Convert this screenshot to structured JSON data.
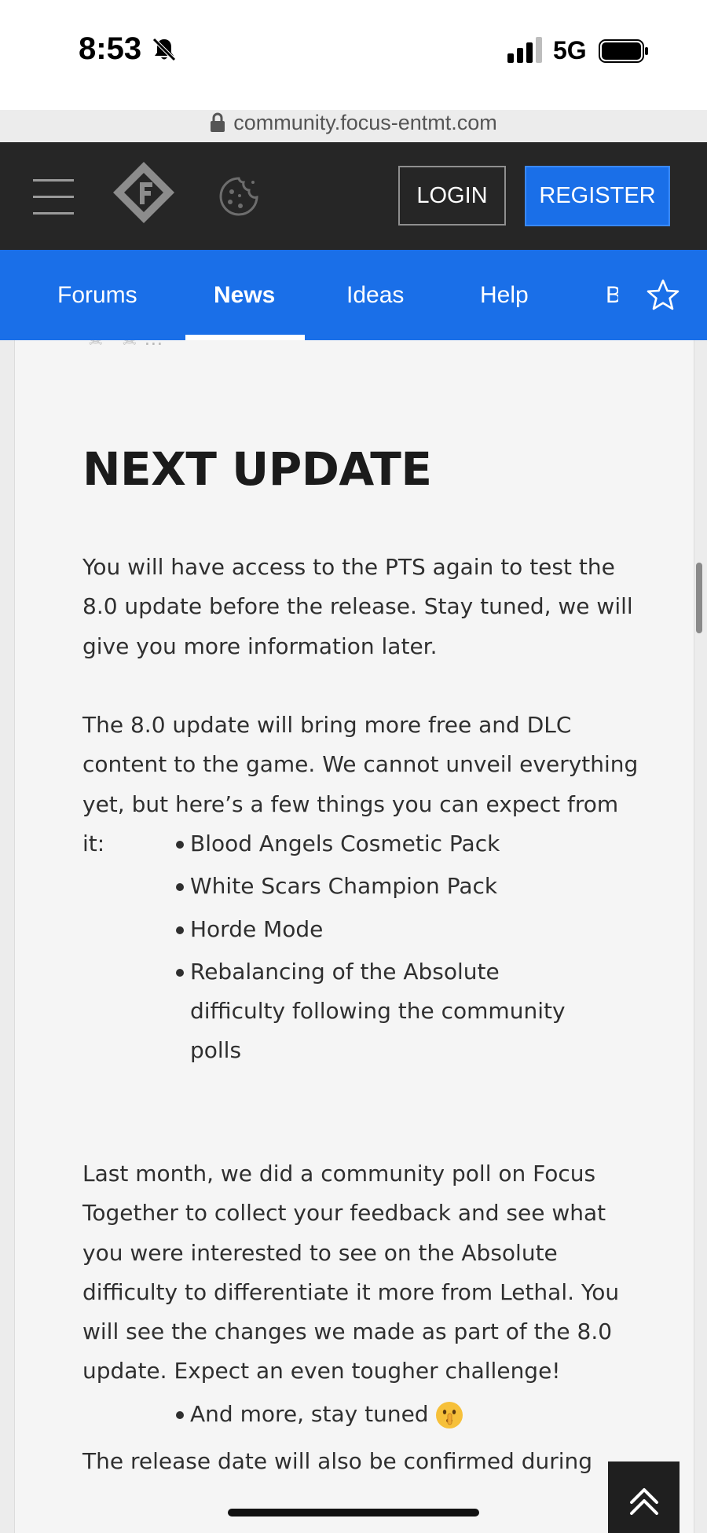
{
  "status": {
    "time": "8:53",
    "network": "5G"
  },
  "browser": {
    "url": "community.focus-entmt.com"
  },
  "header": {
    "login_label": "LOGIN",
    "register_label": "REGISTER"
  },
  "subnav": {
    "tabs": [
      "Forums",
      "News",
      "Ideas",
      "Help",
      "B"
    ],
    "active": "News"
  },
  "article": {
    "top_fragment": "…",
    "heading": "NEXT UPDATE",
    "para1": "You will have access to the PTS again to test the 8.0 update before the release. Stay tuned, we will give you more information later.",
    "para2": "The 8.0 update will bring more free and DLC content to the game. We cannot unveil everything yet, but here’s a few things you can expect from it:",
    "list1": [
      "Blood Angels Cosmetic Pack",
      "White Scars Champion Pack",
      "Horde Mode",
      "Rebalancing of the Absolute difficulty following the community polls"
    ],
    "para3": "Last month, we did a community poll on Focus Together to collect your feedback and see what you were interested to see on the Absolute difficulty to differentiate it more from Lethal. You will see the changes we made as part of the 8.0 update. Expect an even tougher challenge!",
    "list2": [
      "And more, stay tuned"
    ],
    "para4": "The release date will also be confirmed during"
  },
  "colors": {
    "nav_bg": "#262626",
    "accent_blue": "#1a6fe8",
    "content_bg": "#f5f5f5",
    "text": "#2f2f2f"
  },
  "icons": [
    "silent-bell-icon",
    "signal-icon",
    "battery-icon",
    "lock-icon",
    "hamburger-menu-icon",
    "site-logo-icon",
    "cookie-icon",
    "star-icon",
    "shushing-face-emoji",
    "scroll-to-top-icon"
  ]
}
